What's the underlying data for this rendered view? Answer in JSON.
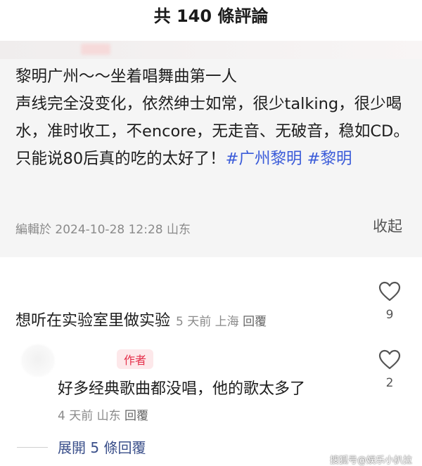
{
  "header": {
    "title": "共 140 條評論"
  },
  "post": {
    "text": "黎明广州～～坐着唱舞曲第一人\n声线完全没变化，依然绅士如常，很少talking，很少喝水，准时收工，不encore，无走音、无破音，稳如CD。只能说80后真的吃的太好了！",
    "tags": [
      "#广州黎明",
      "#黎明"
    ],
    "meta": "編輯於  2024-10-28 12:28 山东",
    "collapse_label": "收起"
  },
  "comment": {
    "text": "想听在实验室里做实验",
    "time": "5 天前",
    "location": "上海",
    "reply_label": "回覆",
    "likes": "9"
  },
  "reply": {
    "badge": "作者",
    "text": "好多经典歌曲都没唱，他的歌太多了",
    "time": "4 天前",
    "location": "山东",
    "reply_label": "回覆",
    "likes": "2"
  },
  "expand_label": "展開 5 條回覆",
  "watermark": "搜狐号@娱乐小扒拉"
}
